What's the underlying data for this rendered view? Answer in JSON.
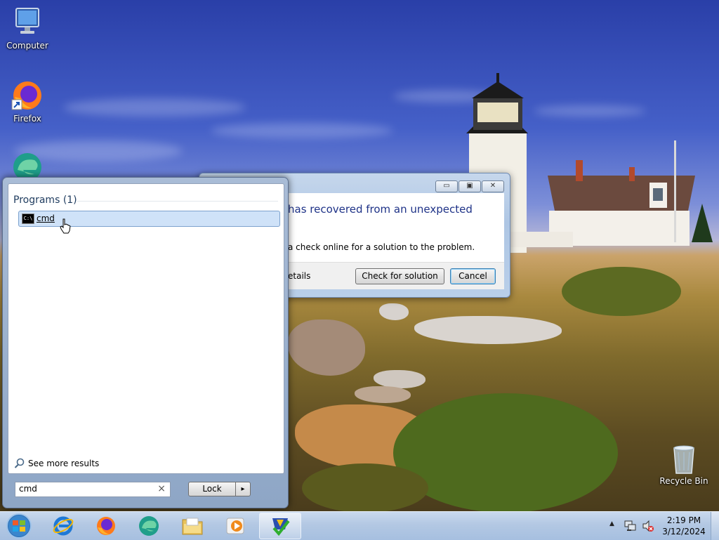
{
  "desktop": {
    "icons": [
      {
        "label": "Computer",
        "icon": "computer-icon"
      },
      {
        "label": "Firefox",
        "icon": "firefox-icon"
      },
      {
        "label": "",
        "icon": "edge-icon"
      },
      {
        "label": "Recycle Bin",
        "icon": "recycle-bin-icon"
      }
    ]
  },
  "dialog": {
    "message_title": "has recovered from an unexpected",
    "message_body": "a check online for a solution to the problem.",
    "details_label": "etails",
    "check_button": "Check for solution",
    "cancel_button": "Cancel",
    "caption_buttons": {
      "minimize": "▭",
      "maximize": "▣",
      "close": "✕"
    }
  },
  "start_menu": {
    "section_header": "Programs (1)",
    "results": [
      {
        "label": "cmd",
        "icon": "cmd-icon",
        "selected": true
      }
    ],
    "see_more": "See more results",
    "search": {
      "value": "cmd",
      "clear": "×"
    },
    "power_button": {
      "label": "Lock",
      "arrow": "▸"
    }
  },
  "taskbar": {
    "pinned": [
      {
        "name": "start-orb",
        "icon": "windows-logo-icon"
      },
      {
        "name": "internet-explorer",
        "icon": "ie-icon"
      },
      {
        "name": "firefox",
        "icon": "firefox-icon"
      },
      {
        "name": "edge",
        "icon": "edge-icon"
      },
      {
        "name": "file-explorer",
        "icon": "folder-icon"
      },
      {
        "name": "media-player",
        "icon": "media-player-icon"
      },
      {
        "name": "active-app",
        "icon": "action-center-checkmark-icon"
      }
    ],
    "tray": {
      "overflow_arrow": "▲",
      "time": "2:19 PM",
      "date": "3/12/2024"
    }
  },
  "colors": {
    "selection_fill": "#cfe2f8",
    "selection_border": "#7da2ce",
    "dialog_title_text": "#1e3287",
    "taskbar": "#b3c8e3"
  }
}
